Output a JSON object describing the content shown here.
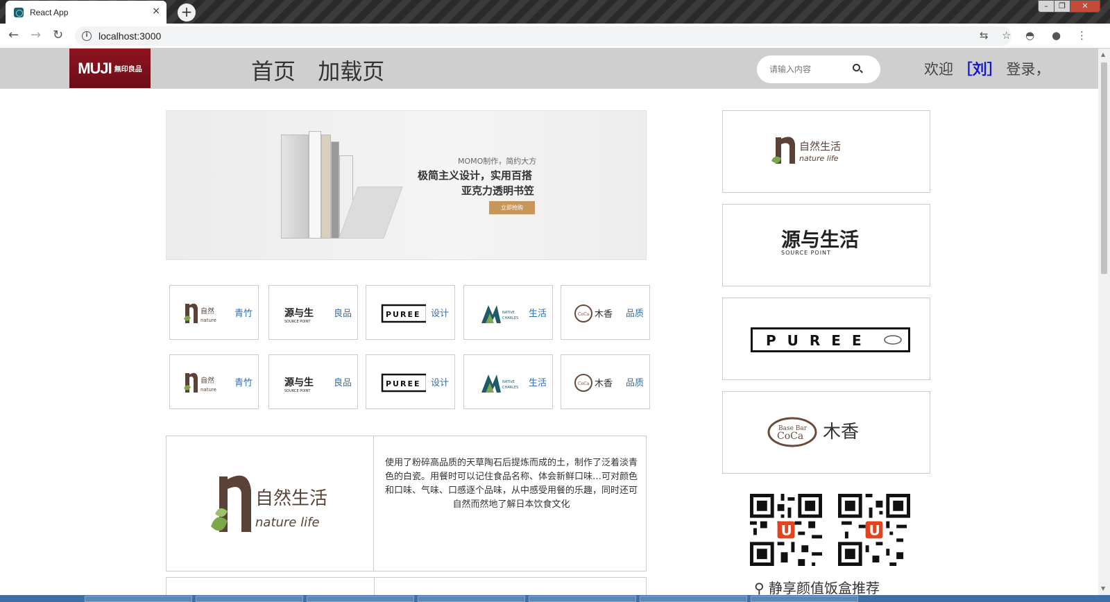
{
  "browser": {
    "tab_title": "React App",
    "tab_close": "×",
    "new_tab": "+",
    "url": "localhost:3000"
  },
  "header": {
    "logo_main": "MUJI",
    "logo_sub": "無印良品",
    "nav": [
      "首页",
      "加载页"
    ],
    "search_placeholder": "请输入内容",
    "welcome_prefix": "欢迎",
    "user": "［刘］",
    "login": "登录，"
  },
  "banner": {
    "small_text": "MOMO制作，简约大方",
    "title_line1": "极简主义设计，实用百搭",
    "title_line2": "亚克力透明书笠",
    "button": "立即抢购"
  },
  "brands": [
    {
      "logo": "自然生活 nature life",
      "label": "青竹"
    },
    {
      "logo": "源与生活 SOURCE POINT",
      "label": "良品"
    },
    {
      "logo": "PUREE",
      "label": "设计"
    },
    {
      "logo": "NATIVE CHARLESWORTH",
      "label": "生活"
    },
    {
      "logo": "Base Bar CoCa 木香",
      "label": "品质"
    }
  ],
  "feature": {
    "logo": "自然生活 nature life",
    "text": "使用了粉碎高品质的天草陶石后提炼而成的土，制作了泛着淡青色的白瓷。用餐时可以记住食品名称、体会新鲜口味…可对颜色和口味、气味、口感逐个品味，从中感受用餐的乐趣，同时还可自然而然地了解日本饮食文化"
  },
  "side_cards": [
    {
      "logo": "自然生活 nature life"
    },
    {
      "logo": "源与生活 SOURCE POINT"
    },
    {
      "logo": "PUREE"
    },
    {
      "logo": "Base Bar CoCa 木香"
    }
  ],
  "side_footer": "静享颜值饭盒推荐",
  "colors": {
    "header_bg": "#cfcfcf",
    "logo_red": "#8e1421",
    "user_blue": "#1414d8",
    "brand_label": "#2e6fb8",
    "banner_btn": "#c8955a"
  }
}
